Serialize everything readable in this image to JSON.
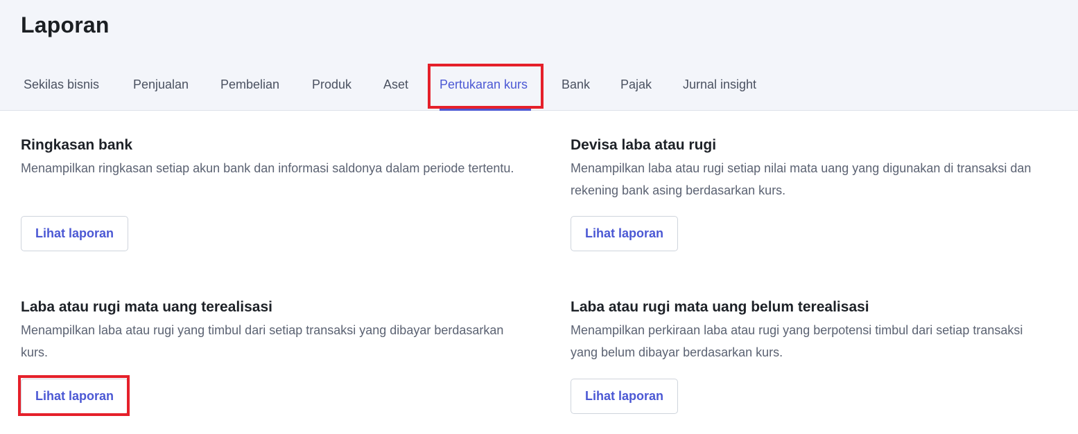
{
  "page": {
    "title": "Laporan"
  },
  "tabs": [
    {
      "label": "Sekilas bisnis",
      "active": false
    },
    {
      "label": "Penjualan",
      "active": false
    },
    {
      "label": "Pembelian",
      "active": false
    },
    {
      "label": "Produk",
      "active": false
    },
    {
      "label": "Aset",
      "active": false
    },
    {
      "label": "Pertukaran kurs",
      "active": true
    },
    {
      "label": "Bank",
      "active": false
    },
    {
      "label": "Pajak",
      "active": false
    },
    {
      "label": "Jurnal insight",
      "active": false
    }
  ],
  "reports": [
    {
      "title": "Ringkasan bank",
      "description": "Menampilkan ringkasan setiap akun bank dan informasi saldonya dalam periode tertentu.",
      "button": "Lihat laporan"
    },
    {
      "title": "Devisa laba atau rugi",
      "description": "Menampilkan laba atau rugi setiap nilai mata uang yang digunakan di transaksi dan rekening bank asing berdasarkan kurs.",
      "button": "Lihat laporan"
    },
    {
      "title": "Laba atau rugi mata uang terealisasi",
      "description": "Menampilkan laba atau rugi yang timbul dari setiap transaksi yang dibayar berdasarkan kurs.",
      "button": "Lihat laporan"
    },
    {
      "title": "Laba atau rugi mata uang belum terealisasi",
      "description": "Menampilkan perkiraan laba atau rugi yang berpotensi timbul dari setiap transaksi yang belum dibayar berdasarkan kurs.",
      "button": "Lihat laporan"
    }
  ],
  "colors": {
    "accent": "#4b58d4",
    "highlight": "#e5202a",
    "header_bg": "#f3f5fa"
  }
}
